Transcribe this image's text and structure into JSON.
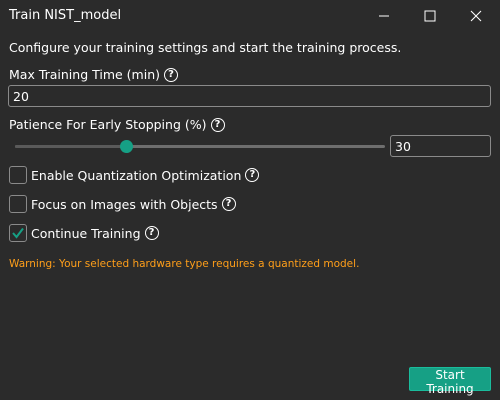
{
  "window": {
    "title": "Train NIST_model",
    "minimize_icon": "minimize-icon",
    "maximize_icon": "maximize-icon",
    "close_icon": "close-icon"
  },
  "intro_text": "Configure your training settings and start the training process.",
  "max_time": {
    "label": "Max Training Time (min)",
    "value": "20",
    "help_icon": "help-icon"
  },
  "patience": {
    "label": "Patience For Early Stopping (%)",
    "value": "30",
    "slider_fraction": 0.3,
    "help_icon": "help-icon"
  },
  "options": [
    {
      "label": "Enable Quantization Optimization",
      "checked": false
    },
    {
      "label": "Focus on Images with Objects",
      "checked": false
    },
    {
      "label": "Continue Training",
      "checked": true
    }
  ],
  "warning": "Warning: Your selected hardware type requires a quantized model.",
  "start_button": "Start Training",
  "colors": {
    "background": "#2b2b2b",
    "accent": "#16a085",
    "warning": "#ff9f1a",
    "text": "#ffffff"
  }
}
